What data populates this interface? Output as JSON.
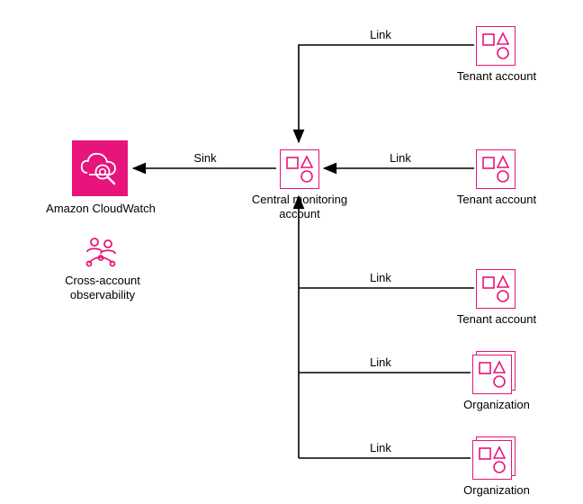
{
  "colors": {
    "accent": "#e7157b",
    "line": "#000000"
  },
  "nodes": {
    "cloudwatch": {
      "label": "Amazon CloudWatch"
    },
    "cross_account": {
      "label": "Cross-account\nobservability"
    },
    "central": {
      "label": "Central monitoring\naccount"
    },
    "tenant1": {
      "label": "Tenant account"
    },
    "tenant2": {
      "label": "Tenant account"
    },
    "tenant3": {
      "label": "Tenant account"
    },
    "org1": {
      "label": "Organization"
    },
    "org2": {
      "label": "Organization"
    }
  },
  "edges": {
    "sink": {
      "label": "Sink"
    },
    "link1": {
      "label": "Link"
    },
    "link2": {
      "label": "Link"
    },
    "link3": {
      "label": "Link"
    },
    "link4": {
      "label": "Link"
    },
    "link5": {
      "label": "Link"
    }
  }
}
